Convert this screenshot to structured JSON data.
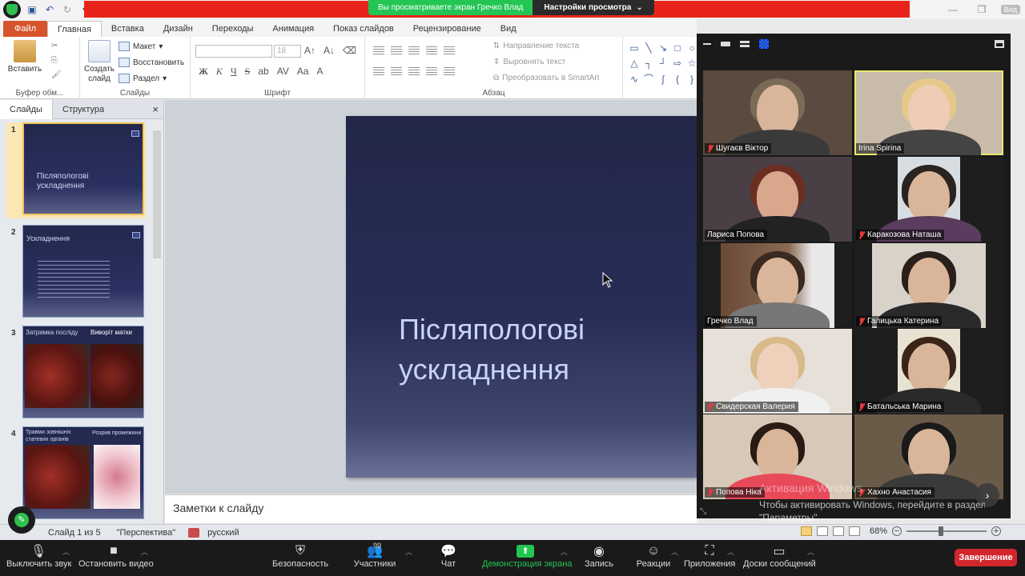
{
  "share_banner": {
    "viewing_text": "Вы просматриваете экран Гречко Влад",
    "settings_label": "Настройки просмотра"
  },
  "window": {
    "view_badge": "Вид"
  },
  "ribbon": {
    "tabs": [
      {
        "label": "Файл"
      },
      {
        "label": "Главная"
      },
      {
        "label": "Вставка"
      },
      {
        "label": "Дизайн"
      },
      {
        "label": "Переходы"
      },
      {
        "label": "Анимация"
      },
      {
        "label": "Показ слайдов"
      },
      {
        "label": "Рецензирование"
      },
      {
        "label": "Вид"
      }
    ],
    "clipboard": {
      "paste_label": "Вставить",
      "group_label": "Буфер обм..."
    },
    "slides": {
      "new_slide_label": "Создать слайд",
      "layout_label": "Макет",
      "reset_label": "Восстановить",
      "section_label": "Раздел",
      "group_label": "Слайды"
    },
    "font": {
      "font_size": "18",
      "group_label": "Шрифт"
    },
    "paragraph": {
      "text_direction_label": "Направление текста",
      "align_text_label": "Выровнять текст",
      "smartart_label": "Преобразовать в SmartArt",
      "group_label": "Абзац"
    }
  },
  "slides_pane": {
    "tab_slides": "Слайды",
    "tab_outline": "Структура",
    "close": "×",
    "thumbs": [
      {
        "num": "1",
        "title": "Післяпологові ускладнення"
      },
      {
        "num": "2",
        "title": "Ускладнення"
      },
      {
        "num": "3",
        "title": "Затримка посліду",
        "title2": "Виворіт матки"
      },
      {
        "num": "4",
        "title": "Травми зовнішніх статевих органів",
        "title2": "Розрив промежини"
      }
    ]
  },
  "current_slide": {
    "title_line1": "Післяпологові",
    "title_line2": "ускладнення"
  },
  "notes": {
    "placeholder": "Заметки к слайду"
  },
  "status_bar": {
    "slide_counter": "Слайд 1 из 5",
    "theme": "\"Перспектива\"",
    "language": "русский",
    "zoom": "68%"
  },
  "gallery": {
    "participants": [
      {
        "name": "Шугаєв Віктор",
        "muted": true
      },
      {
        "name": "Irina Spirina",
        "muted": false
      },
      {
        "name": "Лариса Попова",
        "muted": false
      },
      {
        "name": "Каракозова Наташа",
        "muted": true
      },
      {
        "name": "Гречко Влад",
        "muted": false
      },
      {
        "name": "Галицька Катерина",
        "muted": true
      },
      {
        "name": "Свидерская Валерия",
        "muted": true
      },
      {
        "name": "Батальська Марина",
        "muted": true
      },
      {
        "name": "Попова Ніка",
        "muted": true
      },
      {
        "name": "Хахно Анастасия",
        "muted": true
      }
    ]
  },
  "watermark": {
    "line1": "Активация Windows",
    "line2": "Чтобы активировать Windows, перейдите в раздел",
    "line3": "\"Параметры\"."
  },
  "toolbar": {
    "mute_label": "Выключить звук",
    "video_label": "Остановить видео",
    "security_label": "Безопасность",
    "participants_label": "Участники",
    "participants_count": "99",
    "chat_label": "Чат",
    "share_label": "Демонстрация экрана",
    "record_label": "Запись",
    "reactions_label": "Реакции",
    "apps_label": "Приложения",
    "whiteboards_label": "Доски сообщений",
    "end_label": "Завершение"
  },
  "colors": {
    "zoom_green": "#23c553",
    "ppt_file_tab": "#d6542b",
    "end_red": "#d2262c",
    "slide_bg": "#23284d"
  }
}
